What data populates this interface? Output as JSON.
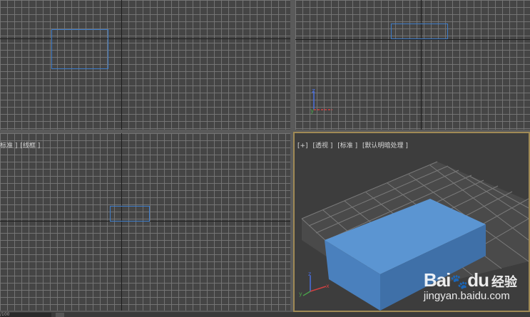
{
  "viewports": {
    "top": {},
    "front": {},
    "left": {
      "label_parts": [
        "标准 ]",
        "[线框 ]"
      ]
    },
    "perspective": {
      "label_parts": [
        "[+]",
        "[透视 ]",
        "[标准 ]",
        "[默认明暗处理 ]"
      ],
      "box_colors": {
        "top": "#5b95d2",
        "front": "#4a80bd",
        "side": "#3f70a8"
      }
    }
  },
  "gizmo": {
    "x_label": "x",
    "y_label": "y",
    "z_label": "z"
  },
  "statusbar": {
    "field_value": "/100"
  },
  "watermark": {
    "brand_text": "Bai",
    "brand_text_2": "du",
    "product": "经验",
    "url": "jingyan.baidu.com"
  },
  "colors": {
    "selection": "#3d7cc9",
    "active_border": "#a08a55",
    "viewport_bg": "#454545"
  }
}
